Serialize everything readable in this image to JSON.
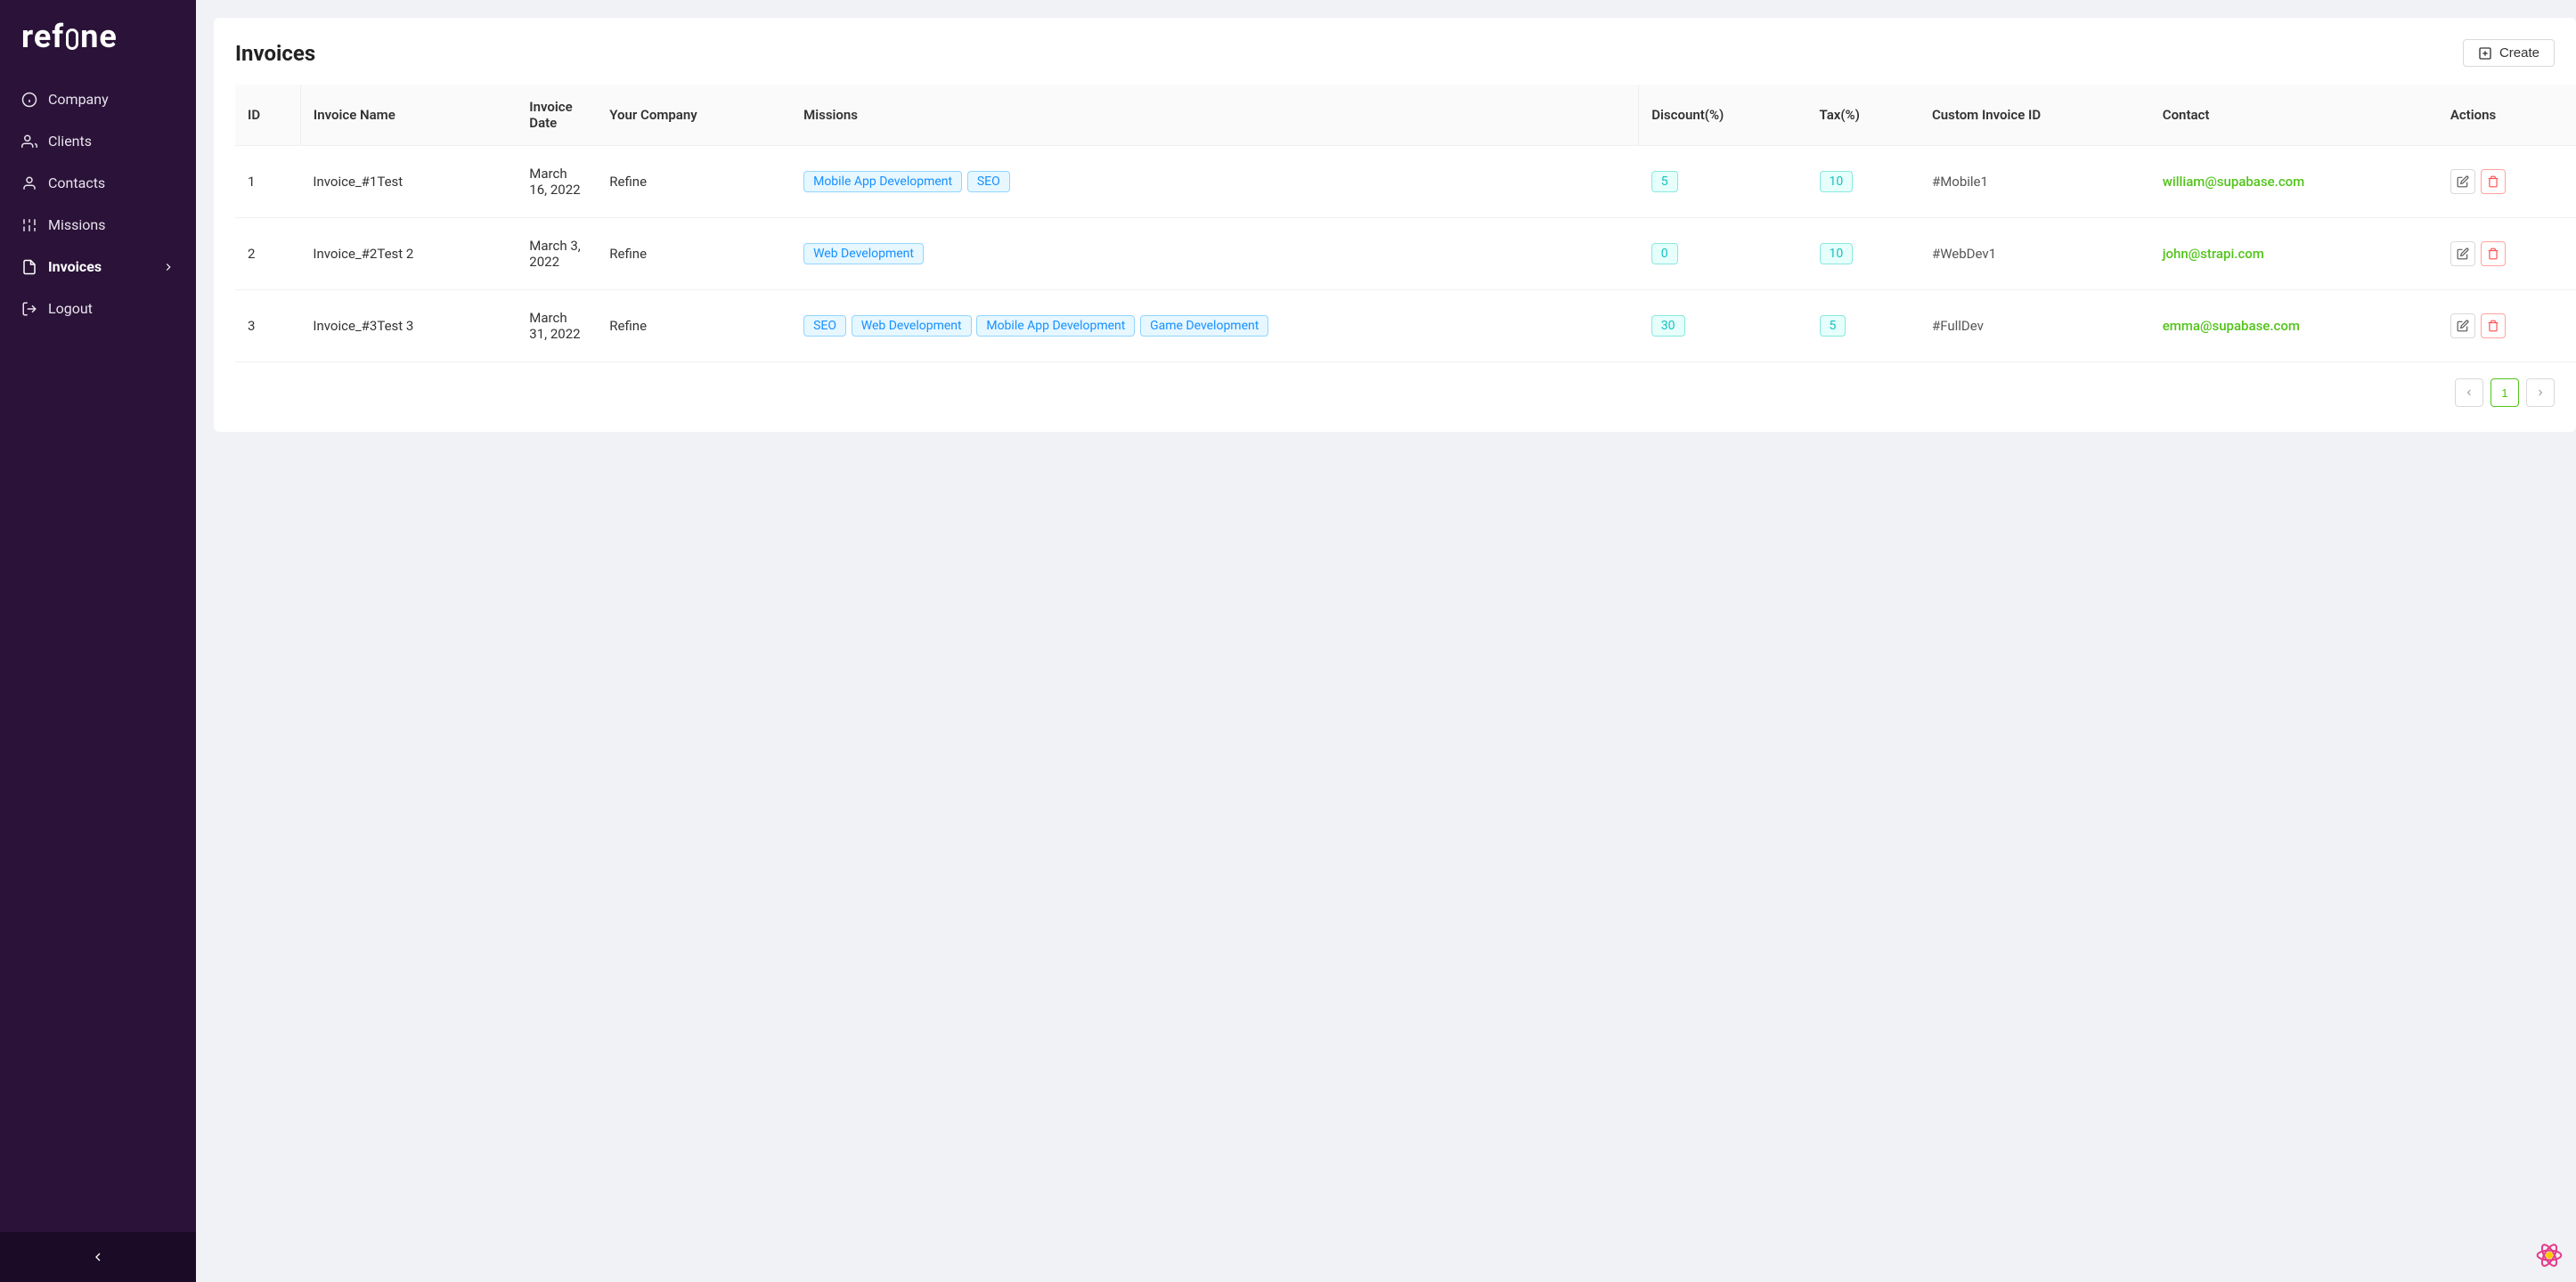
{
  "logo": "refine",
  "nav": [
    {
      "label": "Company",
      "icon": "info"
    },
    {
      "label": "Clients",
      "icon": "person-group"
    },
    {
      "label": "Contacts",
      "icon": "person"
    },
    {
      "label": "Missions",
      "icon": "sliders"
    },
    {
      "label": "Invoices",
      "icon": "file",
      "active": true
    },
    {
      "label": "Logout",
      "icon": "logout"
    }
  ],
  "page": {
    "title": "Invoices",
    "createLabel": "Create"
  },
  "columns": [
    "ID",
    "Invoice Name",
    "Invoice Date",
    "Your Company",
    "Missions",
    "Discount(%)",
    "Tax(%)",
    "Custom Invoice ID",
    "Contact",
    "Actions"
  ],
  "rows": [
    {
      "id": "1",
      "name": "Invoice_#1Test",
      "date": "March 16, 2022",
      "company": "Refine",
      "missions": [
        "Mobile App Development",
        "SEO"
      ],
      "discount": "5",
      "tax": "10",
      "customId": "#Mobile1",
      "contact": "william@supabase.com"
    },
    {
      "id": "2",
      "name": "Invoice_#2Test 2",
      "date": "March 3, 2022",
      "company": "Refine",
      "missions": [
        "Web Development"
      ],
      "discount": "0",
      "tax": "10",
      "customId": "#WebDev1",
      "contact": "john@strapi.com"
    },
    {
      "id": "3",
      "name": "Invoice_#3Test 3",
      "date": "March 31, 2022",
      "company": "Refine",
      "missions": [
        "SEO",
        "Web Development",
        "Mobile App Development",
        "Game Development"
      ],
      "discount": "30",
      "tax": "5",
      "customId": "#FullDev",
      "contact": "emma@supabase.com"
    }
  ],
  "pager": {
    "current": "1"
  }
}
